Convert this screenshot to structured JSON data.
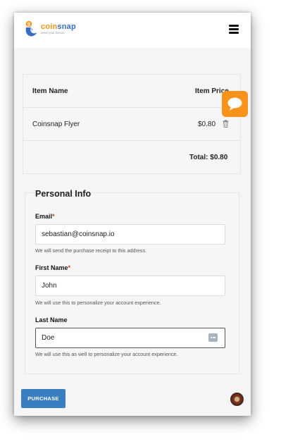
{
  "header": {
    "brand_name_a": "coin",
    "brand_name_b": "snap",
    "brand_tagline": "send your bitcoin"
  },
  "cart": {
    "col_item_name": "Item Name",
    "col_item_price": "Item Price",
    "items": [
      {
        "name": "Coinsnap Flyer",
        "price": "$0.80"
      }
    ],
    "total": "Total: $0.80"
  },
  "form": {
    "title": "Personal Info",
    "email": {
      "label": "Email",
      "required_mark": "*",
      "value": "sebastian@coinsnap.io",
      "help": "We will send the purchase receipt to this address."
    },
    "first_name": {
      "label": "First Name",
      "required_mark": "*",
      "value": "John",
      "help": "We will use this to personalize your account experience."
    },
    "last_name": {
      "label": "Last Name",
      "value": "Doe",
      "help": "We will use this as well to personalize your account experience."
    }
  },
  "actions": {
    "purchase_label": "PURCHASE"
  },
  "colors": {
    "accent_orange": "#f7931a",
    "button_blue": "#3a7ec2"
  }
}
